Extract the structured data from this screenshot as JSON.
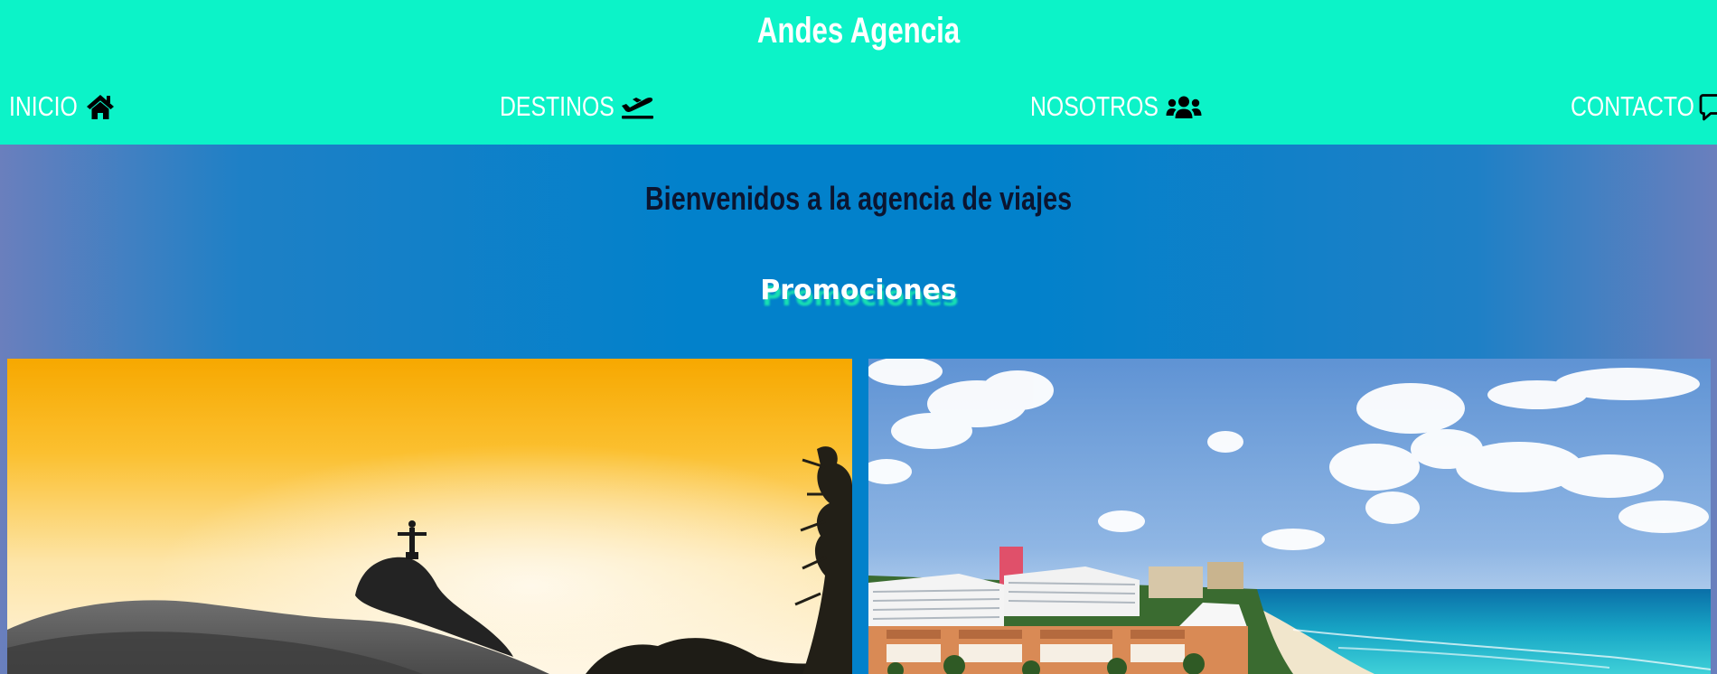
{
  "header": {
    "title": "Andes Agencia",
    "background": "#0cf3c8"
  },
  "nav": {
    "items": [
      {
        "label": "INICIO",
        "icon": "home-icon"
      },
      {
        "label": "DESTINOS",
        "icon": "plane-departure-icon"
      },
      {
        "label": "NOSOTROS",
        "icon": "users-icon"
      },
      {
        "label": "CONTACTO",
        "icon": "chat-bubble-icon"
      }
    ]
  },
  "main": {
    "welcome": "Bienvenidos a la agencia de viajes",
    "promotions_title": "Promociones",
    "accent": "#0281cb"
  },
  "promotions": [
    {
      "image": "christ-the-redeemer-sunset-photo"
    },
    {
      "image": "beach-hotels-coast-photo"
    }
  ]
}
